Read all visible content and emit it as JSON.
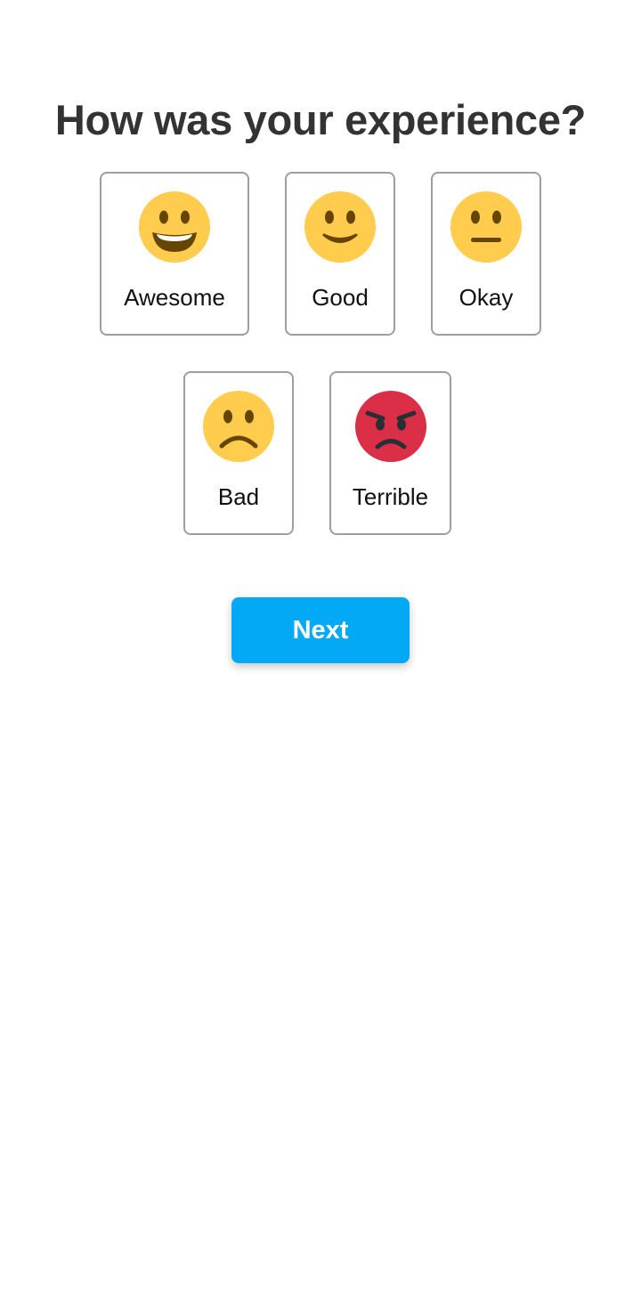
{
  "title": "How was your experience?",
  "options": [
    {
      "label": "Awesome",
      "icon": "grinning-face-icon",
      "color": "#FFCC4D"
    },
    {
      "label": "Good",
      "icon": "slightly-smiling-face-icon",
      "color": "#FFCC4D"
    },
    {
      "label": "Okay",
      "icon": "neutral-face-icon",
      "color": "#FFCC4D"
    },
    {
      "label": "Bad",
      "icon": "frowning-face-icon",
      "color": "#FFCC4D"
    },
    {
      "label": "Terrible",
      "icon": "angry-face-icon",
      "color": "#DA2F47"
    }
  ],
  "next_button": {
    "label": "Next",
    "color": "#03A9F4"
  }
}
